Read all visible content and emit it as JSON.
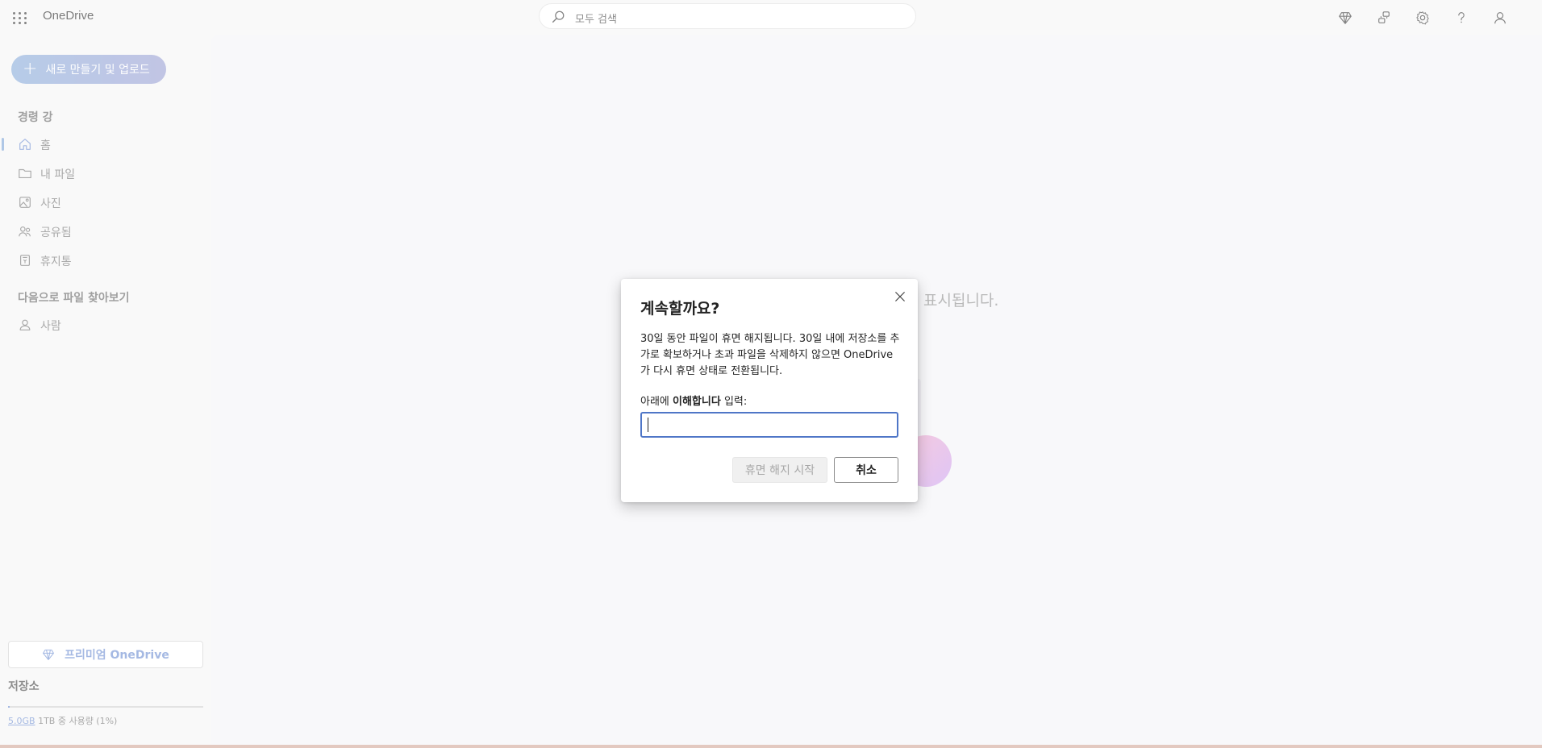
{
  "app": {
    "title": "OneDrive"
  },
  "search": {
    "placeholder": "모두 검색"
  },
  "top_icons": [
    "premium-diamond-icon",
    "sync-settings-icon",
    "gear-icon",
    "help-icon",
    "account-icon"
  ],
  "sidebar": {
    "create_label": "새로 만들기 및 업로드",
    "user_name": "경령 강",
    "items": [
      {
        "label": "홈",
        "icon": "home-icon",
        "selected": true
      },
      {
        "label": "내 파일",
        "icon": "folder-icon"
      },
      {
        "label": "사진",
        "icon": "image-icon"
      },
      {
        "label": "공유됨",
        "icon": "people-icon"
      },
      {
        "label": "휴지통",
        "icon": "recycle-bin-icon"
      }
    ],
    "browse_title": "다음으로 파일 찾아보기",
    "browse_items": [
      {
        "label": "사람",
        "icon": "person-icon"
      }
    ],
    "premium_label": "프리미엄 OneDrive",
    "storage_title": "저장소",
    "storage_used": "5.0GB",
    "storage_rest": " 1TB 중 사용량 (1%)",
    "storage_fraction": 0.01
  },
  "main": {
    "background_text": "표시됩니다."
  },
  "dialog": {
    "title": "계속할까요?",
    "body": "30일 동안 파일이 휴면 해지됩니다. 30일 내에 저장소를 추가로 확보하거나 초과 파일을 삭제하지 않으면 OneDrive가 다시 휴면 상태로 전환됩니다.",
    "prompt_prefix": "아래에 ",
    "prompt_keyword": "이해합니다",
    "prompt_suffix": " 입력:",
    "input_value": "",
    "primary_label": "휴면 해지 시작",
    "cancel_label": "취소"
  },
  "colors": {
    "accent": "#4f76c7",
    "create_gradient_start": "#7ba2d6",
    "create_gradient_end": "#8f95d0"
  }
}
